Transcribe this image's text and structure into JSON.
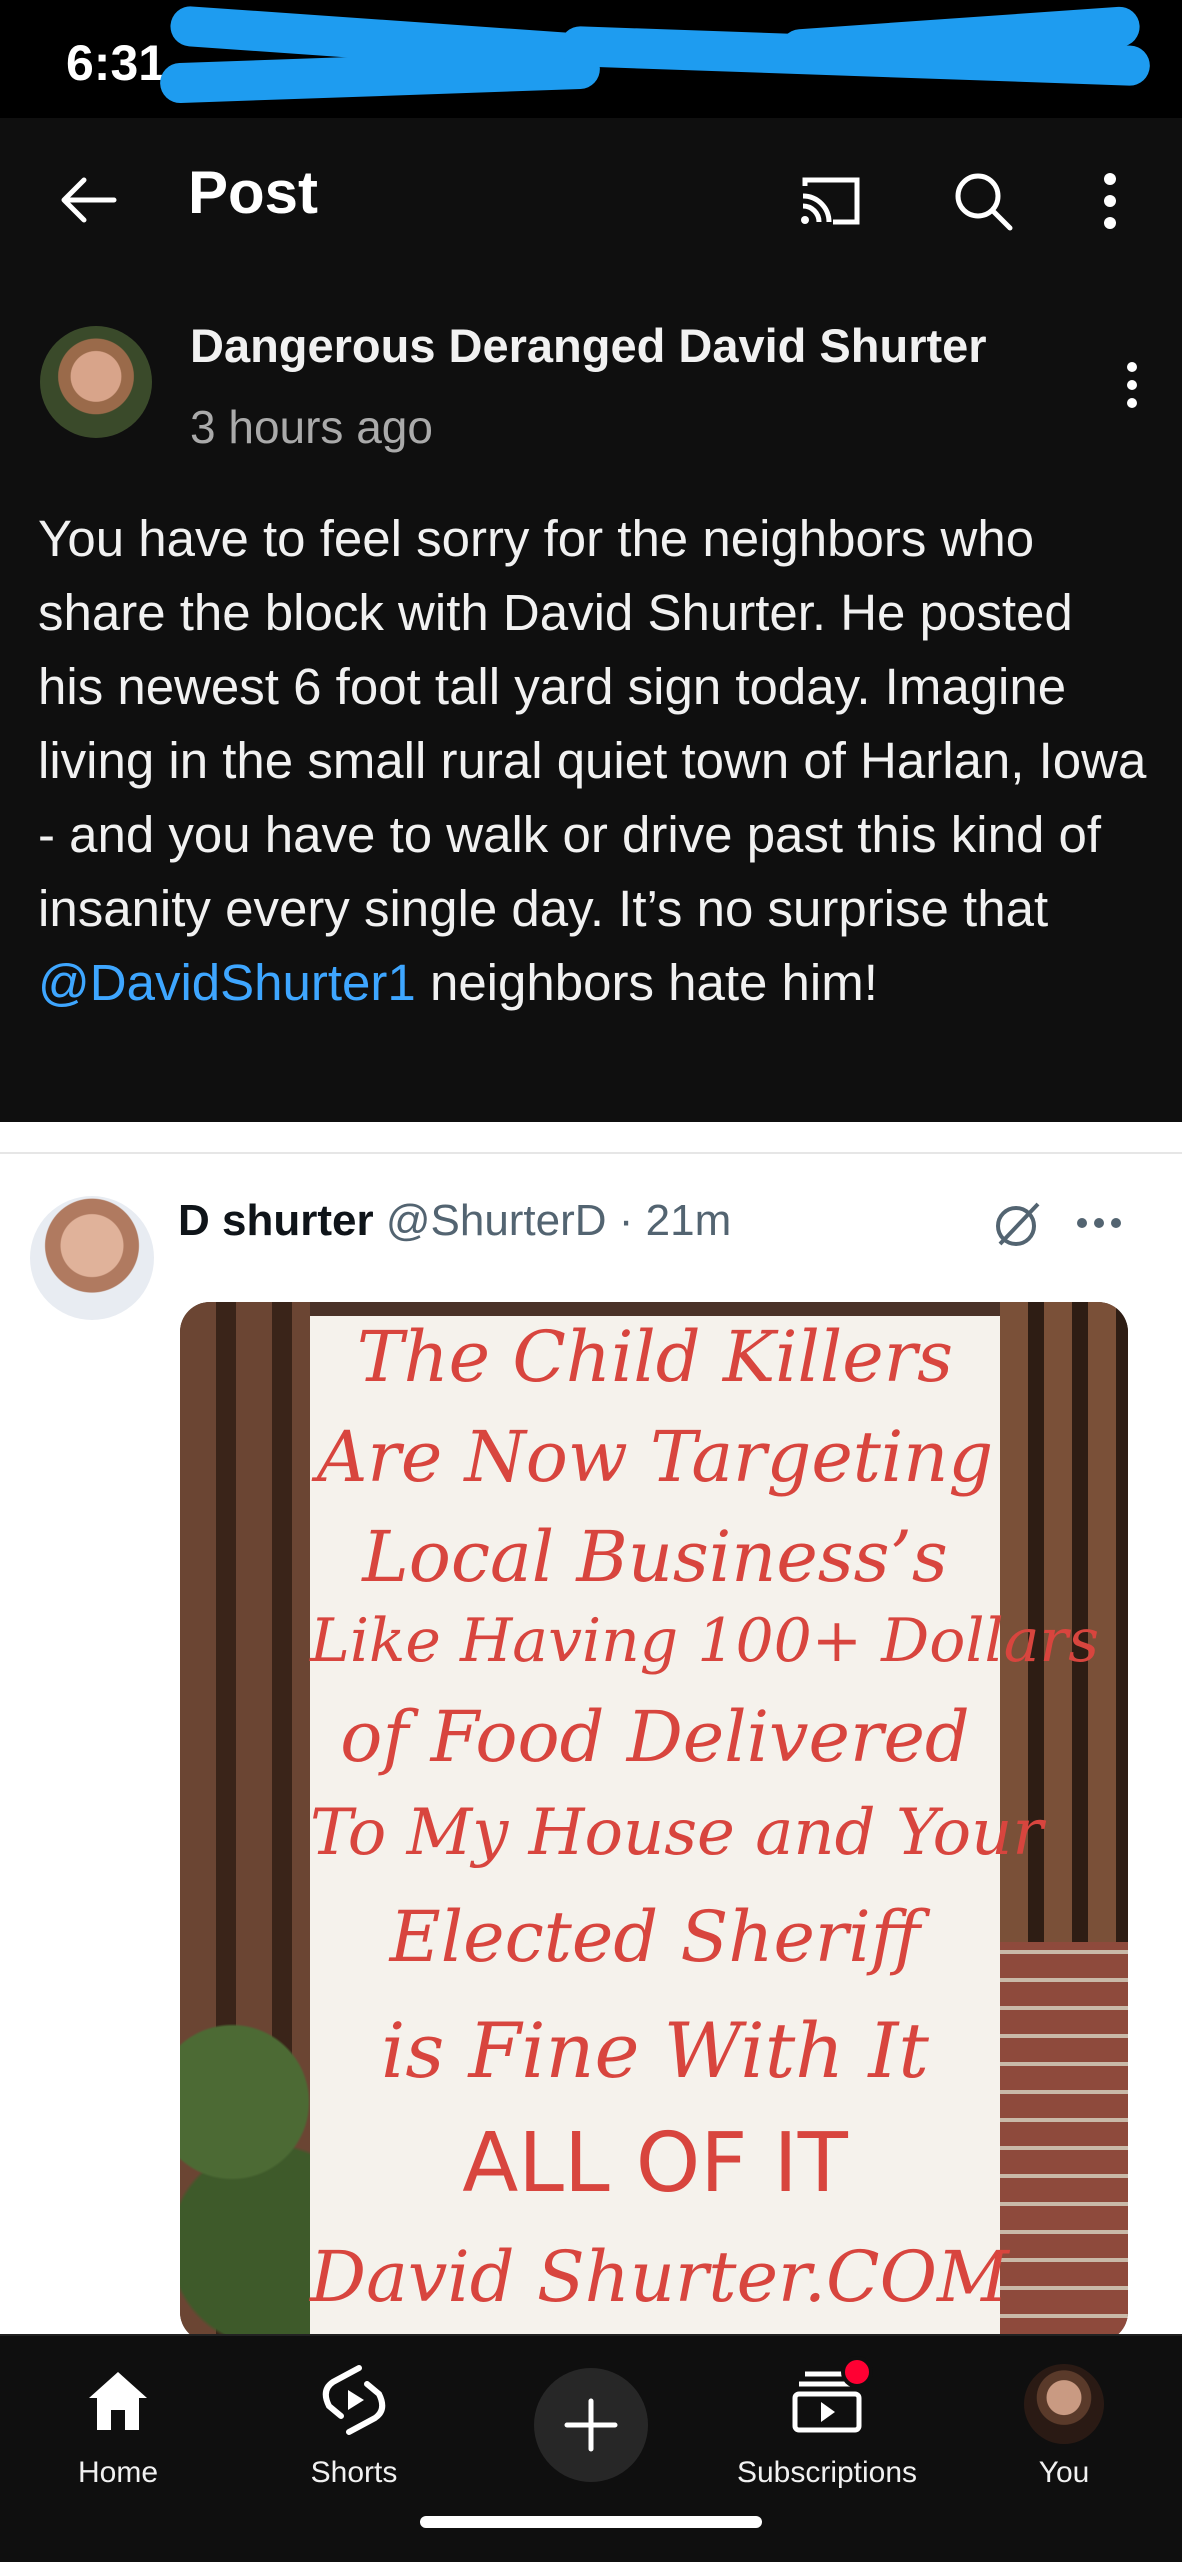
{
  "status_bar": {
    "time": "6:31",
    "redaction_color": "#1e9cf0"
  },
  "app_bar": {
    "title": "Post",
    "back_icon": "arrow-left-icon",
    "cast_icon": "cast-icon",
    "search_icon": "search-icon",
    "more_icon": "more-vertical-icon"
  },
  "post": {
    "author": "Dangerous Deranged David Shurter",
    "time": "3 hours ago",
    "text_before_mention": "You have to feel sorry for the neighbors who share the block with David Shurter.  He posted his newest 6 foot tall yard sign today. Imagine living in the small rural quiet town of Harlan, Iowa - and you have to walk or drive past this kind of insanity every single day.  It’s no surprise that ",
    "mention": "@DavidShurter1",
    "text_after_mention": " neighbors hate him!",
    "mention_color": "#3ea6ff"
  },
  "embedded_tweet": {
    "name": "D shurter",
    "handle": "@ShurterD",
    "separator": " · ",
    "time": "21m",
    "sign_lines": [
      "The Child Killers",
      "Are Now Targeting",
      "Local Business’s",
      "Like Having 100+ Dollars",
      "of Food Delivered",
      "To My House and Your",
      "Elected Sheriff",
      "is Fine With It",
      "ALL OF IT",
      "David Shurter.COM"
    ],
    "sign_text_color": "#d8453e"
  },
  "bottom_nav": {
    "items": [
      {
        "label": "Home",
        "icon": "home-icon"
      },
      {
        "label": "Shorts",
        "icon": "shorts-icon"
      },
      {
        "label": "",
        "icon": "create-plus-icon"
      },
      {
        "label": "Subscriptions",
        "icon": "subscriptions-icon"
      },
      {
        "label": "You",
        "icon": "avatar"
      }
    ]
  }
}
